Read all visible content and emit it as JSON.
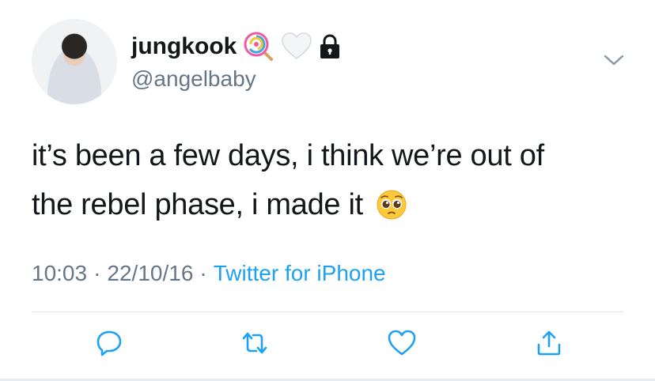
{
  "tweet": {
    "display_name": "jungkook",
    "handle": "@angelbaby",
    "name_emojis": [
      "lollipop-icon",
      "white-heart-icon",
      "lock-icon"
    ],
    "text_line1": "it’s been a few days, i think we’re out of",
    "text_line2": "the rebel phase, i made it",
    "text_emoji": "pleading-face-icon",
    "time": "10:03",
    "separator": "·",
    "date": "22/10/16",
    "source": "Twitter for iPhone"
  },
  "actions": [
    "reply-icon",
    "retweet-icon",
    "like-icon",
    "share-icon"
  ],
  "colors": {
    "text": "#14171a",
    "secondary": "#657786",
    "link": "#1da1f2",
    "icon": "#1da1f2",
    "divider": "#e1e8ed"
  }
}
